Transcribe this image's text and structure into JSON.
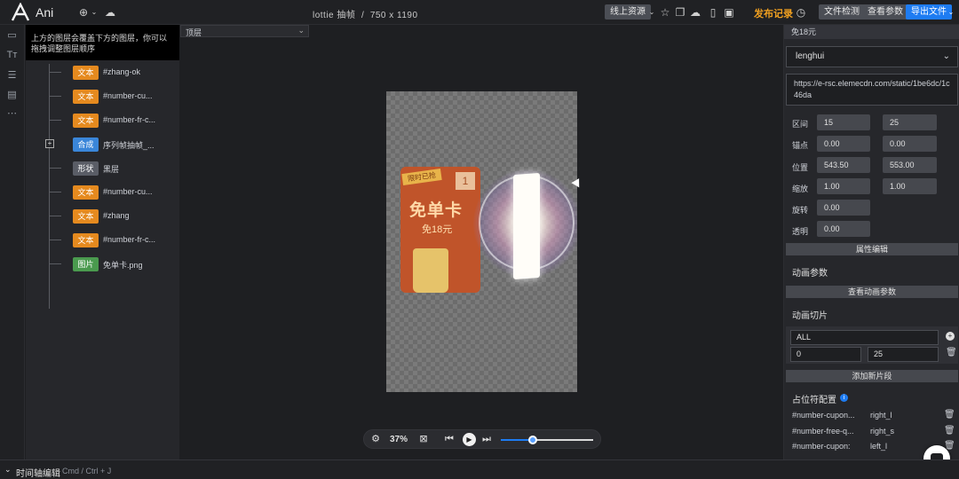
{
  "app": {
    "name": "Ani"
  },
  "header": {
    "doc_title": "lottie 抽帧",
    "doc_size": "750 x 1190",
    "resource_label": "线上资源",
    "publish_label": "发布记录",
    "file_check_label": "文件检测",
    "view_params_label": "查看参数",
    "export_label": "导出文件"
  },
  "layers": {
    "hint": "上方的图层会覆盖下方的图层，你可以拖拽调整图层顺序",
    "items": [
      {
        "tag": "文本",
        "name": "#zhang-ok",
        "color": "#e58a1f"
      },
      {
        "tag": "文本",
        "name": "#number-cu...",
        "color": "#e58a1f"
      },
      {
        "tag": "文本",
        "name": "#number-fr-c...",
        "color": "#e58a1f"
      },
      {
        "tag": "合成",
        "name": "序列帧抽帧_...",
        "color": "#3a86d9"
      },
      {
        "tag": "形状",
        "name": "黑层",
        "color": "#5a5d66"
      },
      {
        "tag": "文本",
        "name": "#number-cu...",
        "color": "#e58a1f"
      },
      {
        "tag": "文本",
        "name": "#zhang",
        "color": "#e58a1f"
      },
      {
        "tag": "文本",
        "name": "#number-fr-c...",
        "color": "#e58a1f"
      },
      {
        "tag": "图片",
        "name": "免单卡.png",
        "color": "#4a9a4e"
      }
    ]
  },
  "canvas": {
    "tab_label": "顶层",
    "card_flag": "限时已抢",
    "card_corner": "1",
    "card_title": "免单卡",
    "card_sub": "免18元"
  },
  "player": {
    "zoom": "37%",
    "progress": 0.35
  },
  "props": {
    "free_label": "免18元",
    "font": "lenghui",
    "url": "https://e-rsc.elemecdn.com/static/1be6dc/1c46da",
    "rows": [
      {
        "label": "区间",
        "v1": "15",
        "v2": "25"
      },
      {
        "label": "锚点",
        "v1": "0.00",
        "v2": "0.00"
      },
      {
        "label": "位置",
        "v1": "543.50",
        "v2": "553.00"
      },
      {
        "label": "缩放",
        "v1": "1.00",
        "v2": "1.00"
      },
      {
        "label": "旋转",
        "v1": "0.00"
      },
      {
        "label": "透明",
        "v1": "0.00"
      }
    ],
    "attr_edit_label": "属性编辑",
    "anim_params_title": "动画参数",
    "view_anim_params_label": "查看动画参数",
    "anim_slice_title": "动画切片",
    "slice_name": "ALL",
    "slice_start": "0",
    "slice_end": "25",
    "add_slice_label": "添加新片段",
    "placeholder_title": "占位符配置",
    "placeholders": [
      {
        "key": "#number-cupon...",
        "value": "right_l"
      },
      {
        "key": "#number-free-q...",
        "value": "right_s"
      },
      {
        "key": "#number-cupon:",
        "value": "left_l"
      }
    ]
  },
  "bottom": {
    "title": "时间轴编辑",
    "hint": "Cmd / Ctrl + J"
  }
}
